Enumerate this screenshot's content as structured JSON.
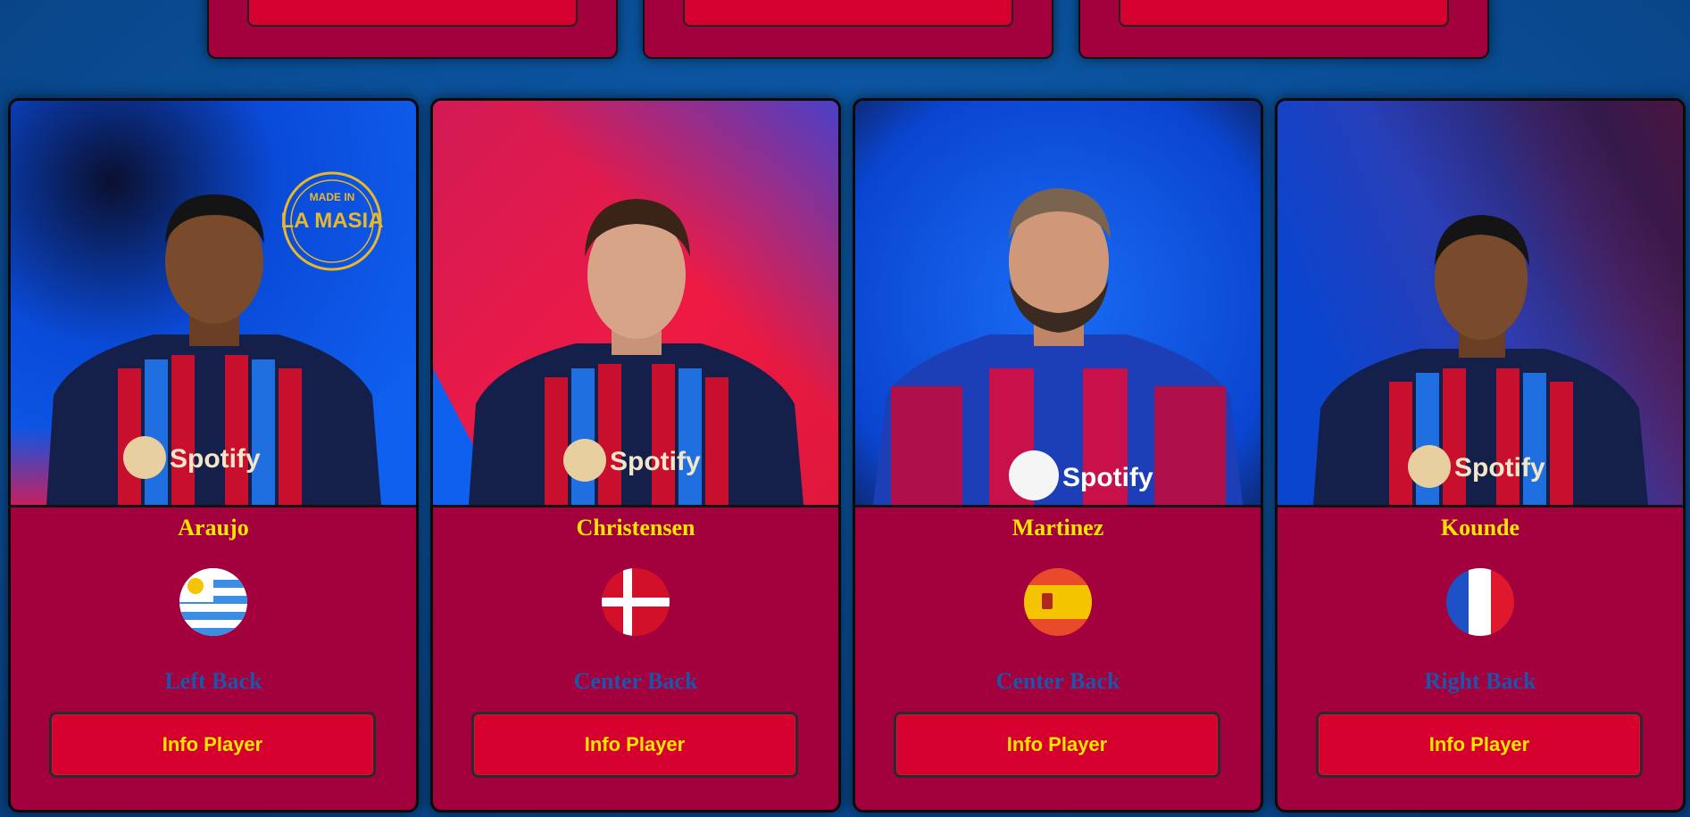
{
  "players": [
    {
      "name": "Araujo",
      "position": "Left Back",
      "country_flag_icon": "uruguay-flag-icon",
      "button_label": "Info Player",
      "badge_text": [
        "MADE IN",
        "LA MASIA"
      ]
    },
    {
      "name": "Christensen",
      "position": "Center Back",
      "country_flag_icon": "denmark-flag-icon",
      "button_label": "Info Player"
    },
    {
      "name": "Martinez",
      "position": "Center Back",
      "country_flag_icon": "spain-flag-icon",
      "button_label": "Info Player"
    },
    {
      "name": "Kounde",
      "position": "Right Back",
      "country_flag_icon": "france-flag-icon",
      "button_label": "Info Player"
    }
  ],
  "sponsor_text": "Spotify",
  "colors": {
    "page_bg": "#0a4f98",
    "card_bg": "#a3003e",
    "button_bg": "#d6002e",
    "name_text": "#ffe600",
    "position_text": "#1f55a8"
  }
}
